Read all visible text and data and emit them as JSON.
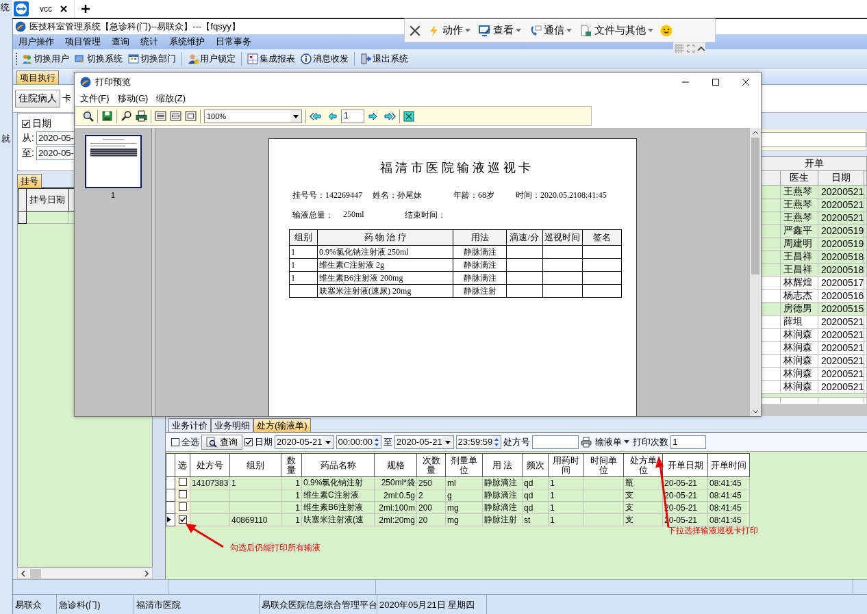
{
  "left_edge": {
    "top_text": "统",
    "side_text": "就"
  },
  "browser_tabs": [
    {
      "label": "vcc",
      "selected": true
    }
  ],
  "window": {
    "title": "医技科室管理系统【急诊科(门)--易联众】---【fqsyy】"
  },
  "menu": [
    "用户操作",
    "项目管理",
    "查询",
    "统计",
    "系统维护",
    "日常事务"
  ],
  "toolbar": [
    [
      "切换用户",
      "切换系统",
      "切换部门"
    ],
    [
      "用户锁定"
    ],
    [
      "集成报表",
      "消息收发"
    ],
    [
      "退出系统"
    ]
  ],
  "main_tabs": [
    {
      "label": "项目执行",
      "selected": true
    }
  ],
  "patient_button": "住院病人",
  "card_label": "卡",
  "date_range": {
    "label": "日期",
    "checked": true,
    "from_label": "从:",
    "from": "2020-05-",
    "to_label": "至:",
    "to": "2020-05-"
  },
  "register_tabs": [
    {
      "label": "挂号",
      "selected": true
    }
  ],
  "register_table": {
    "columns": [
      "挂号日期"
    ]
  },
  "orders_table": {
    "group_header": "开单",
    "columns": [
      "医生",
      "日期"
    ],
    "rows": [
      {
        "doctor": "王燕琴",
        "date": "20200521",
        "highlighted": true
      },
      {
        "doctor": "王燕琴",
        "date": "20200521",
        "highlighted": true
      },
      {
        "doctor": "王燕琴",
        "date": "20200521",
        "highlighted": true
      },
      {
        "doctor": "严鑫平",
        "date": "20200519",
        "highlighted": true
      },
      {
        "doctor": "周建明",
        "date": "20200519",
        "highlighted": true
      },
      {
        "doctor": "王昌祥",
        "date": "20200518",
        "highlighted": true
      },
      {
        "doctor": "王昌祥",
        "date": "20200518",
        "highlighted": true
      },
      {
        "doctor": "林辉煌",
        "date": "20200517",
        "highlighted": false
      },
      {
        "doctor": "杨志杰",
        "date": "20200516",
        "highlighted": false
      },
      {
        "doctor": "房德男",
        "date": "20200515",
        "highlighted": true
      },
      {
        "doctor": "薛坦",
        "date": "20200521",
        "highlighted": false
      },
      {
        "doctor": "林润森",
        "date": "20200521",
        "highlighted": false
      },
      {
        "doctor": "林润森",
        "date": "20200521",
        "highlighted": false
      },
      {
        "doctor": "林润森",
        "date": "20200521",
        "highlighted": false
      },
      {
        "doctor": "林润森",
        "date": "20200521",
        "highlighted": false
      },
      {
        "doctor": "林润森",
        "date": "20200521",
        "highlighted": false
      }
    ]
  },
  "detail_tabs": [
    {
      "label": "业务计价",
      "selected": false
    },
    {
      "label": "业务明细",
      "selected": false
    },
    {
      "label": "处方(输液单)",
      "selected": true
    }
  ],
  "prescription_filter": {
    "select_all": {
      "label": "全选",
      "checked": false
    },
    "query_button": "查询",
    "date": {
      "label": "日期",
      "checked": true
    },
    "from_date": "2020-05-21",
    "from_time": "00:00:00",
    "to_label": "至",
    "to_date": "2020-05-21",
    "to_time": "23:59:59",
    "number_label": "处方号",
    "print_type": "输液单",
    "print_count_label": "打印次数",
    "print_count": "1"
  },
  "prescription_table": {
    "select_column": "选",
    "columns": [
      "处方号",
      "组别",
      "数量",
      "药品名称",
      "规格",
      "次数量",
      "剂量单位",
      "用 法",
      "频次",
      "用药时间",
      "时间单位",
      "处方单位",
      "开单日期",
      "开单时间"
    ],
    "rows": [
      {
        "current": false,
        "checked": false,
        "cells": [
          "14107383",
          "1",
          "1",
          "0.9%氯化钠注射",
          "250ml*袋",
          "250",
          "ml",
          "静脉滴注",
          "qd",
          "1",
          null,
          "瓶",
          "20-05-21",
          "08:41:45"
        ]
      },
      {
        "current": false,
        "checked": false,
        "cells": [
          null,
          null,
          "1",
          "维生素C注射液",
          "2ml:0.5g",
          "2",
          "g",
          "静脉滴注",
          "qd",
          "1",
          null,
          "支",
          "20-05-21",
          "08:41:45"
        ]
      },
      {
        "current": false,
        "checked": false,
        "cells": [
          null,
          null,
          "1",
          "维生素B6注射液",
          "2ml:100m",
          "200",
          "mg",
          "静脉滴注",
          "qd",
          "1",
          null,
          "支",
          "20-05-21",
          "08:41:45"
        ]
      },
      {
        "current": true,
        "checked": true,
        "cells": [
          null,
          "40869110",
          "1",
          "呋塞米注射液(速",
          "2ml:20mg",
          "20",
          "mg",
          "静脉注射",
          "st",
          "1",
          null,
          "支",
          "20-05-21",
          "08:41:45"
        ]
      }
    ]
  },
  "annotations": [
    {
      "text": "勾选后仍能打印所有输液"
    },
    {
      "text": "下拉选择输液巡视卡打印"
    }
  ],
  "status_bar": [
    "易联众",
    "急诊科(门)",
    "福清市医院",
    "易联众医院信息综合管理平台",
    "2020年05月21日 星期四"
  ],
  "print_preview": {
    "title": "打印预览",
    "menu": [
      "文件(F)",
      "移动(G)",
      "缩放(Z)"
    ],
    "zoom": "100%",
    "page": "1",
    "thumbnail_label": "1",
    "card": {
      "title": "福 清 市 医 院 输 液 巡 视 卡",
      "fields": [
        {
          "label": "挂号号：",
          "value": "142269447"
        },
        {
          "label": "姓名：",
          "value": "孙尾妹"
        },
        {
          "label": "年龄：",
          "value": "68岁"
        },
        {
          "label": "时间：",
          "value": "2020.05.2108:41:45"
        }
      ],
      "total_label": "输液总量：",
      "total": "250ml",
      "end_label": "结束时间：",
      "columns": [
        "组别",
        "药 物 治 疗",
        "用法",
        "滴速/分",
        "巡视时间",
        "签名"
      ],
      "rows": [
        [
          "1",
          "0.9%氯化钠注射液 250ml",
          "静脉滴注"
        ],
        [
          "1",
          "维生素C注射液 2g",
          "静脉滴注"
        ],
        [
          "1",
          "维生素B6注射液 200mg",
          "静脉滴注"
        ],
        [
          null,
          "呋塞米注射液(速尿) 20mg",
          "静脉注射"
        ]
      ]
    }
  },
  "remote_toolbar": {
    "items": [
      "动作",
      "查看",
      "通信",
      "文件与其他"
    ]
  }
}
